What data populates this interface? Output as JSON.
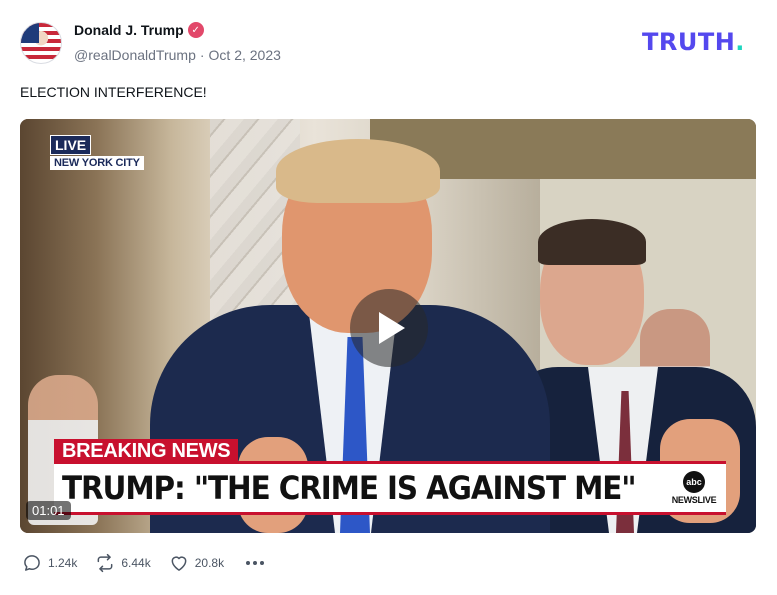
{
  "author": {
    "display_name": "Donald J. Trump",
    "handle": "@realDonaldTrump",
    "separator": "·",
    "date": "Oct 2, 2023",
    "verified_icon": "verified-badge-icon"
  },
  "brand": {
    "logo_text": "TRUTH",
    "logo_dot": "."
  },
  "post": {
    "text": "ELECTION INTERFERENCE!"
  },
  "video": {
    "live_label": "LIVE",
    "location": "NEW YORK CITY",
    "banner_label": "BREAKING NEWS",
    "headline": "TRUMP: \"THE CRIME IS AGAINST ME\"",
    "network_logo": "abc",
    "network_label": "NEWSLIVE",
    "duration": "01:01",
    "play_icon": "play-icon"
  },
  "actions": {
    "replies": "1.24k",
    "retruths": "6.44k",
    "likes": "20.8k"
  },
  "colors": {
    "brand": "#5448ee",
    "brand_dot": "#1ed6c0",
    "verified": "#e2486a",
    "breaking_red": "#c8102e"
  }
}
